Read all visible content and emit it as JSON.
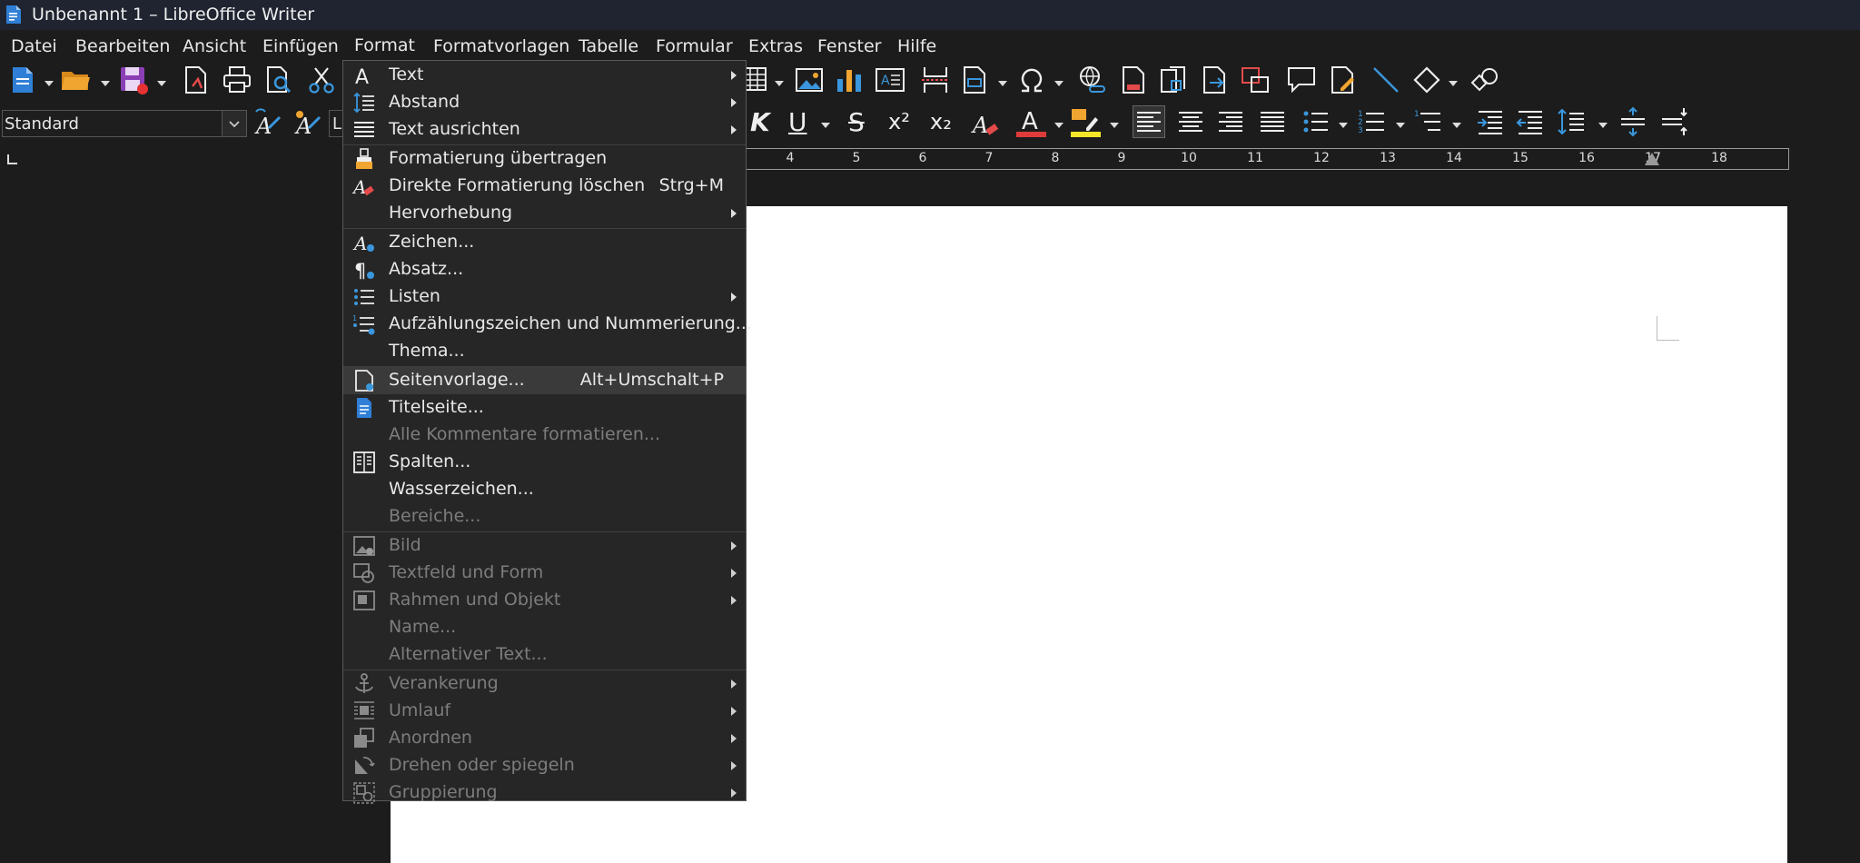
{
  "window": {
    "title": "Unbenannt 1 – LibreOffice Writer",
    "app_icon": "writer-document-icon"
  },
  "menubar": {
    "items": [
      "Datei",
      "Bearbeiten",
      "Ansicht",
      "Einfügen",
      "Format",
      "Formatvorlagen",
      "Tabelle",
      "Formular",
      "Extras",
      "Fenster",
      "Hilfe"
    ],
    "active": "Format"
  },
  "formatting_bar": {
    "paragraph_style": "Standard",
    "font_name_visible": "L",
    "formatting_glyphs": {
      "italic": "K",
      "underline": "U",
      "strikethrough": "S",
      "superscript": "x²",
      "subscript": "x₂"
    }
  },
  "colors": {
    "font_color": "#e03b3b",
    "highlight_color": "#f5e62a",
    "accent": "#3a97dd",
    "menu_highlight": "#3a3a3a"
  },
  "ruler": {
    "numbers": [
      "4",
      "5",
      "6",
      "7",
      "8",
      "9",
      "10",
      "11",
      "12",
      "13",
      "14",
      "15",
      "16",
      "17",
      "18"
    ]
  },
  "format_menu": {
    "items": [
      {
        "label": "Text",
        "icon": "text-a-icon",
        "submenu": true,
        "enabled": true
      },
      {
        "label": "Abstand",
        "icon": "spacing-icon",
        "submenu": true,
        "enabled": true
      },
      {
        "label": "Text ausrichten",
        "icon": "align-icon",
        "submenu": true,
        "enabled": true
      },
      {
        "label": "Formatierung übertragen",
        "icon": "clone-brush-icon",
        "enabled": true
      },
      {
        "label": "Direkte Formatierung löschen",
        "shortcut": "Strg+M",
        "icon": "clear-format-icon",
        "enabled": true
      },
      {
        "label": "Hervorhebung",
        "submenu": true,
        "enabled": true
      },
      {
        "label": "Zeichen...",
        "icon": "character-icon",
        "enabled": true
      },
      {
        "label": "Absatz...",
        "icon": "paragraph-icon",
        "enabled": true
      },
      {
        "label": "Listen",
        "icon": "list-icon",
        "submenu": true,
        "enabled": true
      },
      {
        "label": "Aufzählungszeichen und Nummerierung...",
        "icon": "bullets-numbering-icon",
        "enabled": true
      },
      {
        "label": "Thema...",
        "enabled": true
      },
      {
        "label": "Seitenvorlage...",
        "shortcut": "Alt+Umschalt+P",
        "icon": "page-style-icon",
        "enabled": true,
        "highlighted": true
      },
      {
        "label": "Titelseite...",
        "icon": "title-page-icon",
        "enabled": true
      },
      {
        "label": "Alle Kommentare formatieren...",
        "enabled": false
      },
      {
        "label": "Spalten...",
        "icon": "columns-icon",
        "enabled": true
      },
      {
        "label": "Wasserzeichen...",
        "enabled": true
      },
      {
        "label": "Bereiche...",
        "enabled": false
      },
      {
        "label": "Bild",
        "icon": "image-icon",
        "submenu": true,
        "enabled": false
      },
      {
        "label": "Textfeld und Form",
        "icon": "textbox-shape-icon",
        "submenu": true,
        "enabled": false
      },
      {
        "label": "Rahmen und Objekt",
        "icon": "frame-object-icon",
        "submenu": true,
        "enabled": false
      },
      {
        "label": "Name...",
        "enabled": false
      },
      {
        "label": "Alternativer Text...",
        "enabled": false
      },
      {
        "label": "Verankerung",
        "icon": "anchor-icon",
        "submenu": true,
        "enabled": false
      },
      {
        "label": "Umlauf",
        "icon": "wrap-icon",
        "submenu": true,
        "enabled": false
      },
      {
        "label": "Anordnen",
        "icon": "arrange-icon",
        "submenu": true,
        "enabled": false
      },
      {
        "label": "Drehen oder spiegeln",
        "icon": "rotate-flip-icon",
        "submenu": true,
        "enabled": false
      },
      {
        "label": "Gruppierung",
        "icon": "group-icon",
        "submenu": true,
        "enabled": false
      }
    ]
  }
}
